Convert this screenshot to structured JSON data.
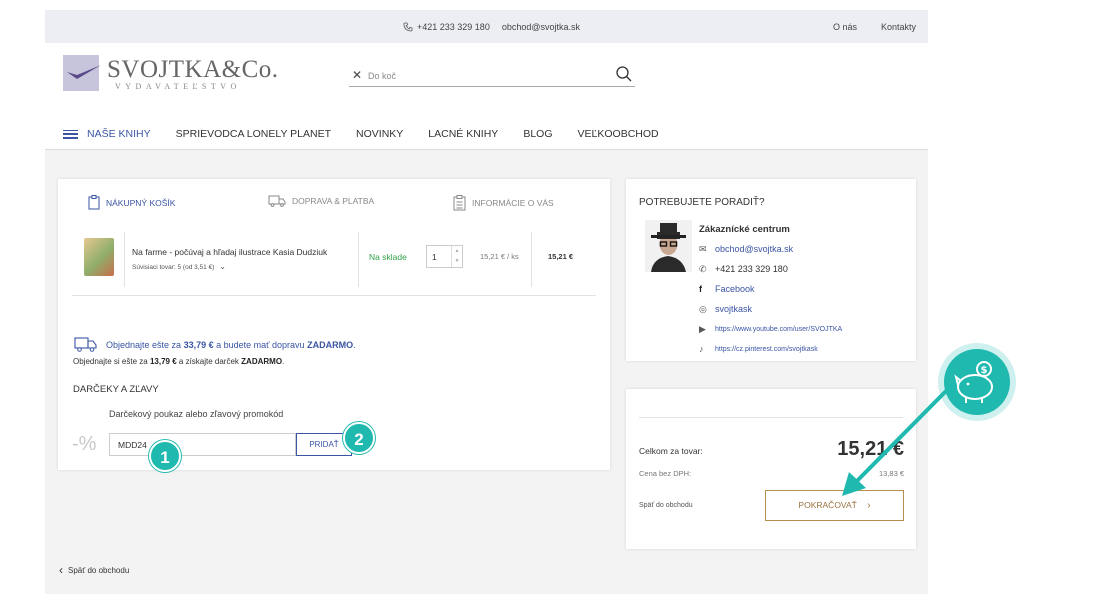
{
  "topbar": {
    "phone": "+421 233 329 180",
    "email": "obchod@svojtka.sk",
    "links": [
      "O nás",
      "Kontakty"
    ]
  },
  "logo": {
    "name": "SVOJTKA&Co.",
    "subtitle": "VYDAVATEĽSTVO"
  },
  "search": {
    "placeholder": "Do koč"
  },
  "nav": {
    "items": [
      "NAŠE KNIHY",
      "SPRIEVODCA LONELY PLANET",
      "NOVINKY",
      "LACNÉ KNIHY",
      "BLOG",
      "VEĽKOOBCHOD"
    ]
  },
  "steps": [
    "NÁKUPNÝ KOŠÍK",
    "DOPRAVA & PLATBA",
    "INFORMÁCIE O VÁS"
  ],
  "cart": {
    "product_title": "Na farme - počúvaj a hľadaj ilustrace Kasia Dudziuk",
    "related": "Súvisiaci tovar: 5 (od 3,51 €)",
    "stock": "Na sklade",
    "quantity": "1",
    "unit_price": "15,21 € / ks",
    "total": "15,21 €"
  },
  "shipping": {
    "msg_prefix": "Objednajte ešte za",
    "msg_amount": "33,79 €",
    "msg_middle": "a budete mať dopravu",
    "msg_free": "ZADARMO",
    "msg_end": "."
  },
  "gift": {
    "prefix": "Objednajte si ešte za",
    "amount": "13,79 €",
    "middle": "a získajte darček",
    "free": "ZADARMO",
    "end": "."
  },
  "discounts": {
    "title": "DARČEKY A ZĽAVY",
    "voucher_label": "Darčekový poukaz alebo zľavový promokód",
    "percent_symbol": "-%",
    "code_value": "MDD24",
    "apply_label": "PRIDAŤ"
  },
  "badges": [
    "1",
    "2"
  ],
  "help": {
    "title": "POTREBUJETE PORADIŤ?",
    "center_name": "Zákaznícké centrum",
    "email": "obchod@svojtka.sk",
    "phone": "+421 233 329 180",
    "facebook": "Facebook",
    "instagram": "svojtkask",
    "youtube": "https://www.youtube.com/user/SVOJTKA",
    "pinterest": "https://cz.pinterest.com/svojtkask"
  },
  "summary": {
    "total_label": "Celkom za tovar:",
    "total_value": "15,21 €",
    "vat_label": "Cena bez DPH:",
    "vat_value": "13,83 €",
    "back_small": "Späť do obchodu",
    "continue_label": "POKRAČOVAŤ"
  },
  "back_link": "Späť do obchodu",
  "colors": {
    "accent_blue": "#3a55a4",
    "teal": "#1fb9b0",
    "gold": "#b88e4f",
    "stock_green": "#2fa04a"
  }
}
